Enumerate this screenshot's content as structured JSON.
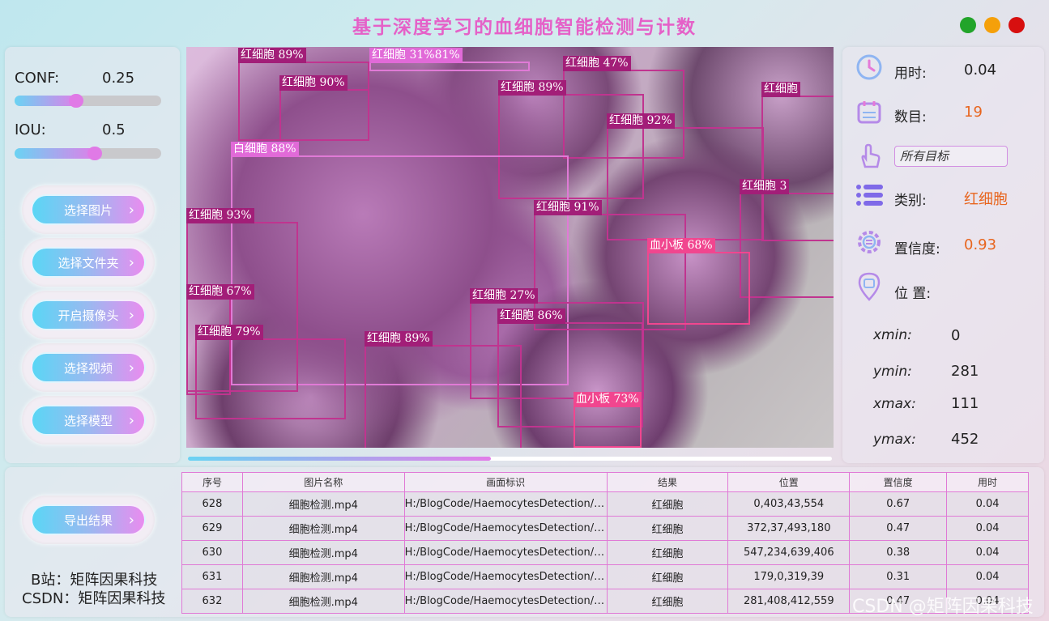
{
  "title": "基于深度学习的血细胞智能检测与计数",
  "window_buttons": {
    "green": "#22a42a",
    "orange": "#f5a00a",
    "red": "#d70f0f"
  },
  "controls": {
    "conf_label": "CONF:",
    "conf_value": "0.25",
    "conf_level": 0.25,
    "iou_label": "IOU:",
    "iou_value": "0.5",
    "iou_level": 0.5
  },
  "buttons": [
    "选择图片",
    "选择文件夹",
    "开启摄像头",
    "选择视频",
    "选择模型"
  ],
  "export_button": "导出结果",
  "detections": [
    {
      "label": "红细胞 89%"
    },
    {
      "label": "红细胞 31%81%"
    },
    {
      "label": "红细胞 47%"
    },
    {
      "label": "红细胞 90%"
    },
    {
      "label": "红细胞 89%"
    },
    {
      "label": "红细胞"
    },
    {
      "label": "红细胞 92%"
    },
    {
      "label": "白细胞 88%"
    },
    {
      "label": "红细胞 3"
    },
    {
      "label": "红细胞 91%"
    },
    {
      "label": "红细胞 93%"
    },
    {
      "label": "血小板 68%"
    },
    {
      "label": "红细胞 67%"
    },
    {
      "label": "红细胞 27%"
    },
    {
      "label": "红细胞 86%"
    },
    {
      "label": "红细胞 79%"
    },
    {
      "label": "红细胞 89%"
    },
    {
      "label": "血小板 73%"
    }
  ],
  "video_progress": 0.47,
  "info": {
    "time_label": "用时:",
    "time_value": "0.04",
    "count_label": "数目:",
    "count_value": "19",
    "target_select": "所有目标",
    "class_label": "类别:",
    "class_value": "红细胞",
    "conf_label": "置信度:",
    "conf_value": "0.93",
    "pos_label": "位 置:",
    "xmin_label": "xmin:",
    "xmin": "0",
    "ymin_label": "ymin:",
    "ymin": "281",
    "xmax_label": "xmax:",
    "xmax": "111",
    "ymax_label": "ymax:",
    "ymax": "452",
    "accent_color": "#e8651e"
  },
  "table": {
    "headers": [
      "序号",
      "图片名称",
      "画面标识",
      "结果",
      "位置",
      "置信度",
      "用时"
    ],
    "rows": [
      [
        "628",
        "细胞检测.mp4",
        "H:/BlogCode/HaemocytesDetection/t...",
        "红细胞",
        "0,403,43,554",
        "0.67",
        "0.04"
      ],
      [
        "629",
        "细胞检测.mp4",
        "H:/BlogCode/HaemocytesDetection/t...",
        "红细胞",
        "372,37,493,180",
        "0.47",
        "0.04"
      ],
      [
        "630",
        "细胞检测.mp4",
        "H:/BlogCode/HaemocytesDetection/t...",
        "红细胞",
        "547,234,639,406",
        "0.38",
        "0.04"
      ],
      [
        "631",
        "细胞检测.mp4",
        "H:/BlogCode/HaemocytesDetection/t...",
        "红细胞",
        "179,0,319,39",
        "0.31",
        "0.04"
      ],
      [
        "632",
        "细胞检测.mp4",
        "H:/BlogCode/HaemocytesDetection/t...",
        "红细胞",
        "281,408,412,559",
        "0.47",
        "0.04"
      ]
    ]
  },
  "credits": {
    "bilibili": "B站：矩阵因果科技",
    "csdn": "CSDN：矩阵因果科技"
  },
  "watermark": "CSDN @矩阵因果科技"
}
